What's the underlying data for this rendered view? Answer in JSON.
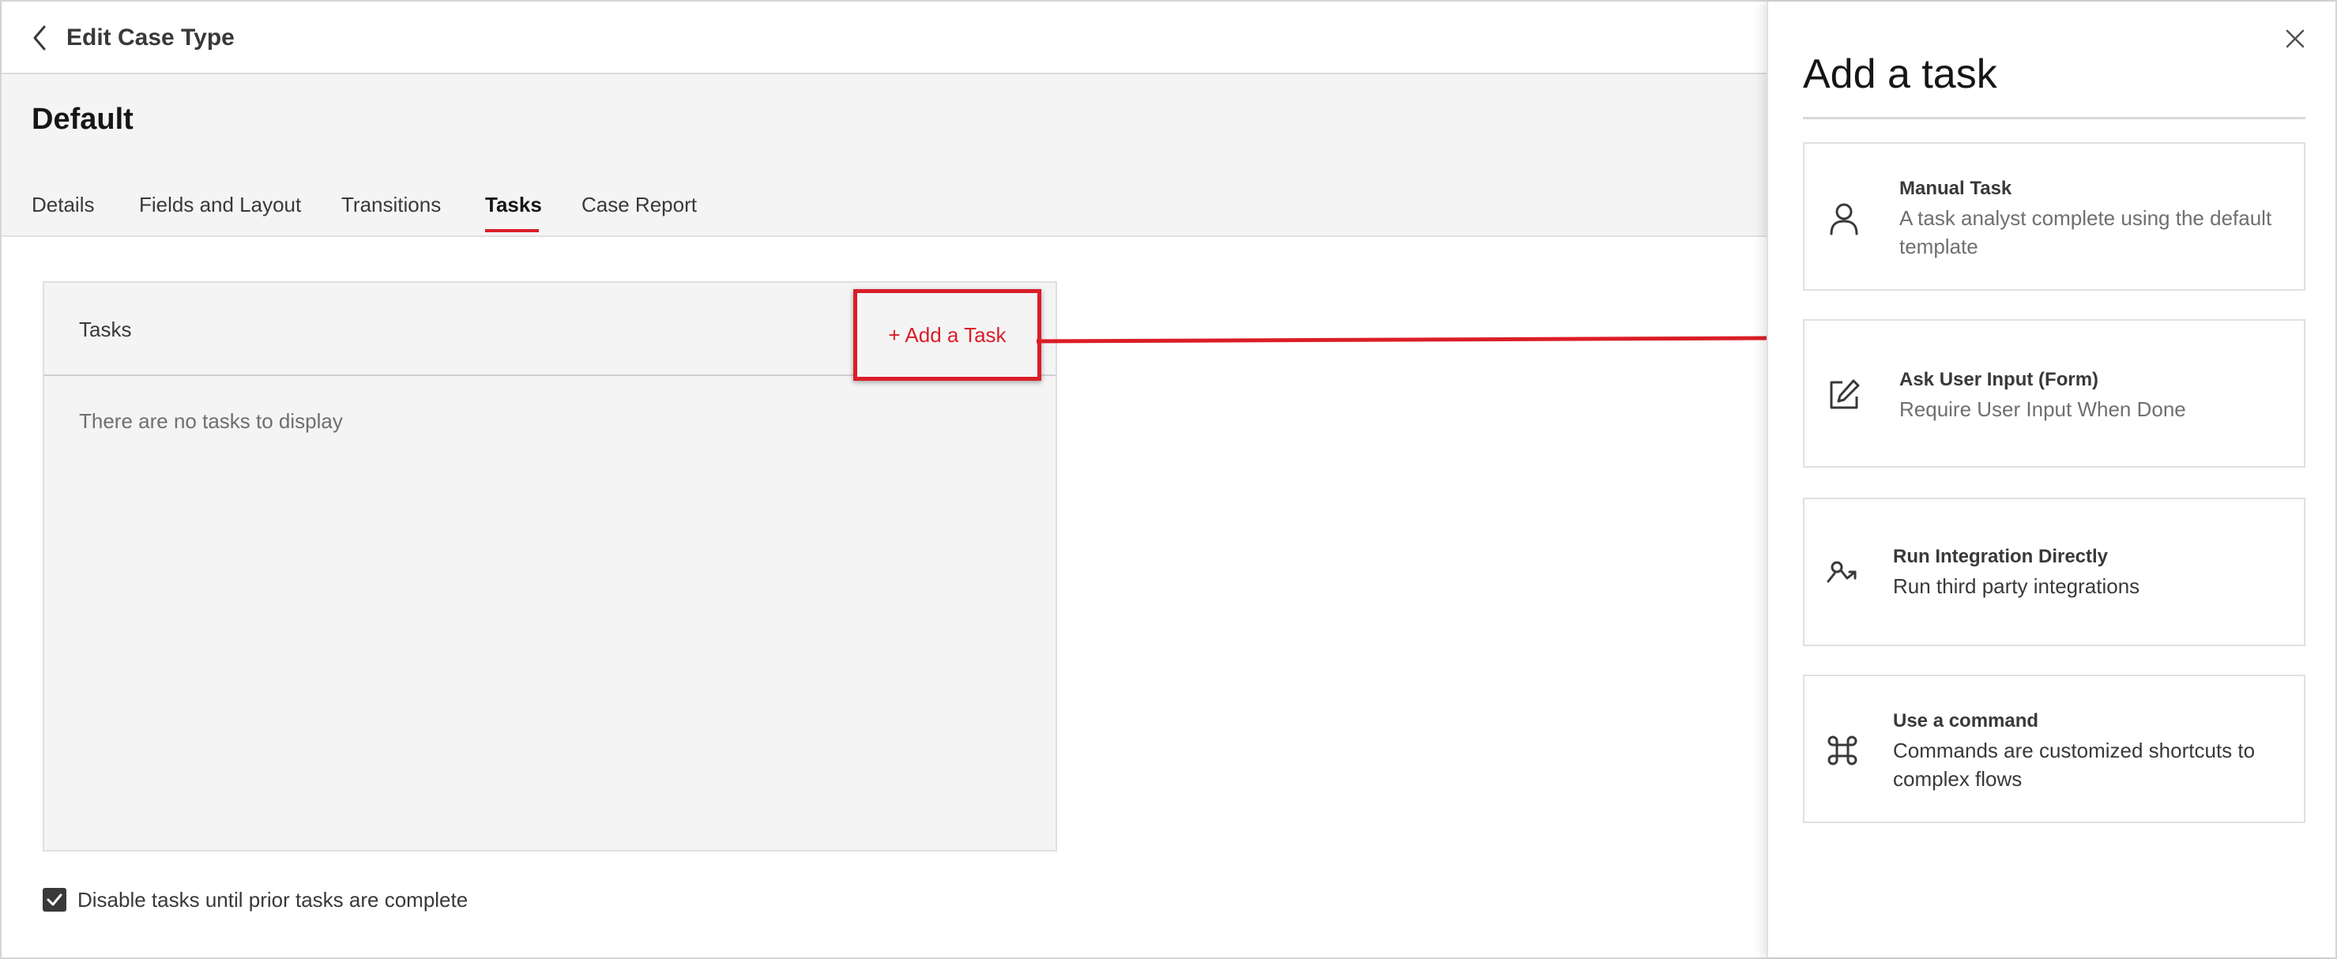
{
  "topbar": {
    "title": "Edit Case Type"
  },
  "case": {
    "title": "Default"
  },
  "tabs": [
    {
      "label": "Details"
    },
    {
      "label": "Fields and Layout"
    },
    {
      "label": "Transitions"
    },
    {
      "label": "Tasks",
      "active": true
    },
    {
      "label": "Case Report"
    }
  ],
  "tasks_panel": {
    "header_label": "Tasks",
    "add_button_label": "+ Add a Task",
    "empty_message": "There are no tasks to display"
  },
  "disable_option": {
    "label": "Disable tasks until prior tasks are complete",
    "checked": true
  },
  "side_panel": {
    "title": "Add a task",
    "options": [
      {
        "icon": "user-icon",
        "title": "Manual Task",
        "description": "A task analyst complete using the default template"
      },
      {
        "icon": "edit-form-icon",
        "title": "Ask User Input (Form)",
        "description": "Require User Input When Done"
      },
      {
        "icon": "integration-icon",
        "title": "Run Integration Directly",
        "description": "Run third party integrations"
      },
      {
        "icon": "command-icon",
        "title": "Use a command",
        "description": "Commands are customized shortcuts to complex flows"
      }
    ]
  },
  "colors": {
    "accent": "#da1e28",
    "header_bg": "#f4f4f4",
    "text_primary": "#161616",
    "text_secondary": "#6f6f6f"
  }
}
